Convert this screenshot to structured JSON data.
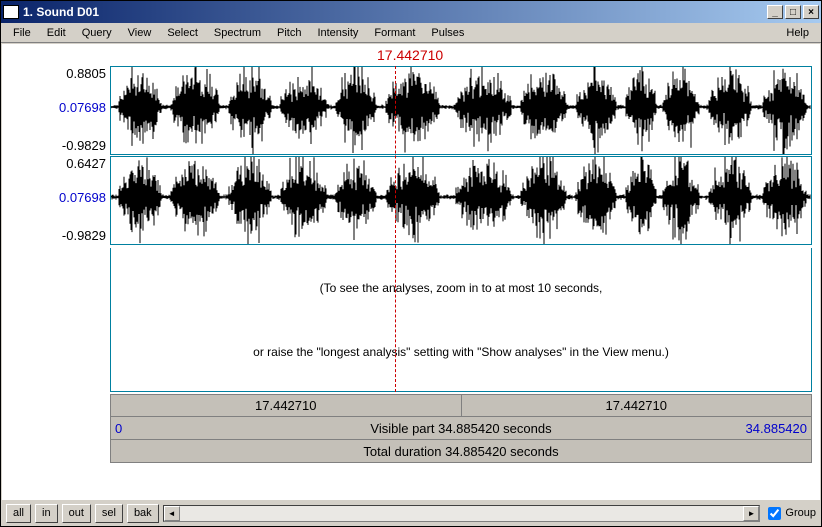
{
  "window": {
    "title": "1. Sound D01"
  },
  "menu": {
    "items": [
      "File",
      "Edit",
      "Query",
      "View",
      "Select",
      "Spectrum",
      "Pitch",
      "Intensity",
      "Formant",
      "Pulses"
    ],
    "help": "Help"
  },
  "cursor": {
    "time": "17.442710"
  },
  "channels": [
    {
      "ymax": "0.8805",
      "ymid": "0.07698",
      "ymin": "-0.9829"
    },
    {
      "ymax": "0.6427",
      "ymid": "0.07698",
      "ymin": "-0.9829"
    }
  ],
  "analysis_hint": {
    "line1": "(To see the analyses, zoom in to at most 10 seconds,",
    "line2": "or raise the \"longest analysis\" setting with \"Show analyses\" in the View menu.)"
  },
  "timebar": {
    "left_time": "17.442710",
    "right_time": "17.442710",
    "visible_start": "0",
    "visible_label": "Visible part 34.885420 seconds",
    "visible_end": "34.885420",
    "total_label": "Total duration 34.885420 seconds"
  },
  "buttons": {
    "all": "all",
    "in": "in",
    "out": "out",
    "sel": "sel",
    "bak": "bak"
  },
  "group": {
    "label": "Group",
    "checked": true
  },
  "colors": {
    "cursor": "#cc0000",
    "link": "#0000cc",
    "border": "#0080a0"
  },
  "chart_data": {
    "type": "waveform",
    "duration_seconds": 34.88542,
    "cursor_seconds": 17.44271,
    "n_channels": 2,
    "note": "dense speech-like stereo audio waveform occupying full visible range"
  }
}
